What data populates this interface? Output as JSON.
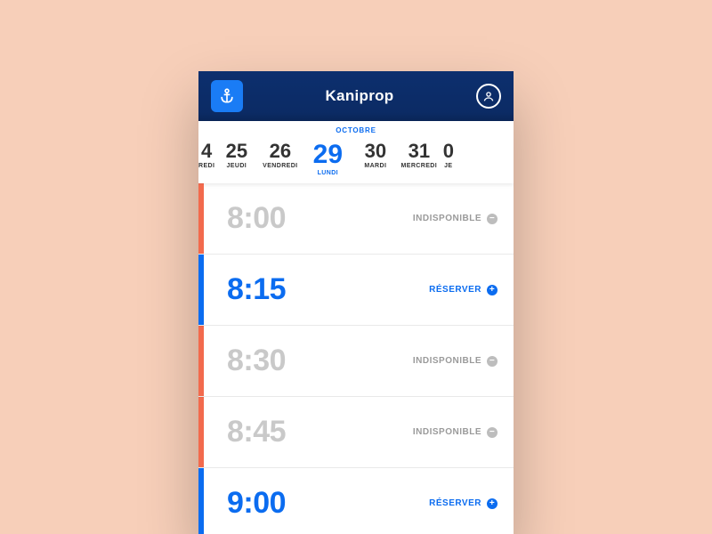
{
  "header": {
    "title": "Kaniprop"
  },
  "date_strip": {
    "month": "OCTOBRE",
    "days": [
      {
        "num": "4",
        "lbl": "REDI",
        "partial": "l"
      },
      {
        "num": "25",
        "lbl": "JEUDI"
      },
      {
        "num": "26",
        "lbl": "VENDREDI"
      },
      {
        "num": "29",
        "lbl": "LUNDI",
        "selected": true
      },
      {
        "num": "30",
        "lbl": "MARDI"
      },
      {
        "num": "31",
        "lbl": "MERCREDI"
      },
      {
        "num": "0",
        "lbl": "JE",
        "partial": "r"
      }
    ]
  },
  "slots": [
    {
      "time": "8:00",
      "status": "INDISPONIBLE",
      "available": false,
      "edge": "orange"
    },
    {
      "time": "8:15",
      "status": "RÉSERVER",
      "available": true,
      "edge": "blue"
    },
    {
      "time": "8:30",
      "status": "INDISPONIBLE",
      "available": false,
      "edge": "orange"
    },
    {
      "time": "8:45",
      "status": "INDISPONIBLE",
      "available": false,
      "edge": "orange"
    },
    {
      "time": "9:00",
      "status": "RÉSERVER",
      "available": true,
      "edge": "blue"
    }
  ]
}
